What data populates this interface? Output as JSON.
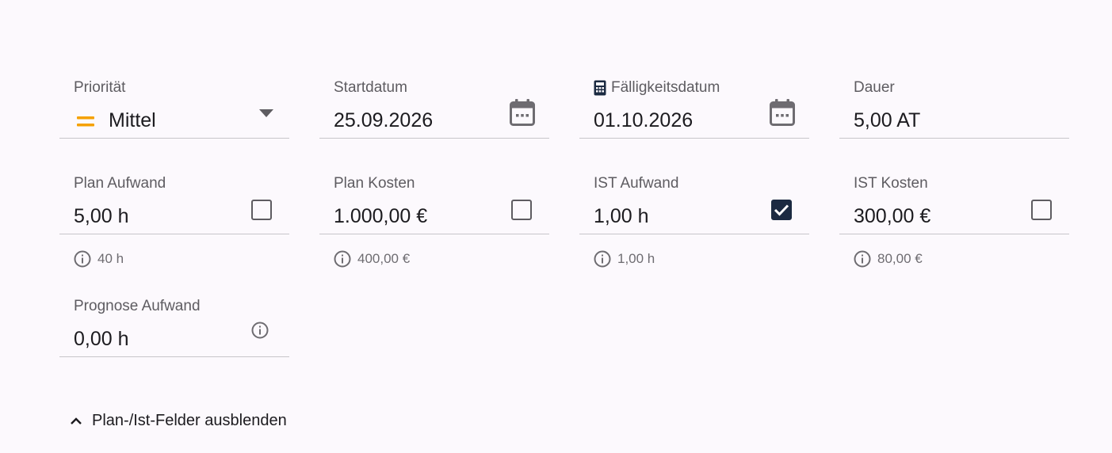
{
  "fields": {
    "prioritaet": {
      "label": "Priorität",
      "value": "Mittel",
      "icon": "priority-medium-icon",
      "icon_color": "#f5a100"
    },
    "startdatum": {
      "label": "Startdatum",
      "value": "25.09.2026"
    },
    "faelligkeitsdatum": {
      "label": "Fälligkeitsdatum",
      "value": "01.10.2026",
      "label_icon": "calculator-icon"
    },
    "dauer": {
      "label": "Dauer",
      "value": "5,00 AT"
    },
    "plan_aufwand": {
      "label": "Plan Aufwand",
      "value": "5,00 h",
      "checked": false,
      "hint": "40 h"
    },
    "plan_kosten": {
      "label": "Plan Kosten",
      "value": "1.000,00 €",
      "checked": false,
      "hint": "400,00 €"
    },
    "ist_aufwand": {
      "label": "IST Aufwand",
      "value": "1,00 h",
      "checked": true,
      "hint": "1,00 h"
    },
    "ist_kosten": {
      "label": "IST Kosten",
      "value": "300,00 €",
      "checked": false,
      "hint": "80,00 €"
    },
    "prognose_aufwand": {
      "label": "Prognose Aufwand",
      "value": "0,00 h"
    }
  },
  "toggle": {
    "label": "Plan-/Ist-Felder ausblenden",
    "icon": "chevron-up-icon"
  },
  "colors": {
    "accent_dark": "#1b2a41",
    "priority_medium": "#f5a100",
    "background": "#fcf9fd"
  }
}
